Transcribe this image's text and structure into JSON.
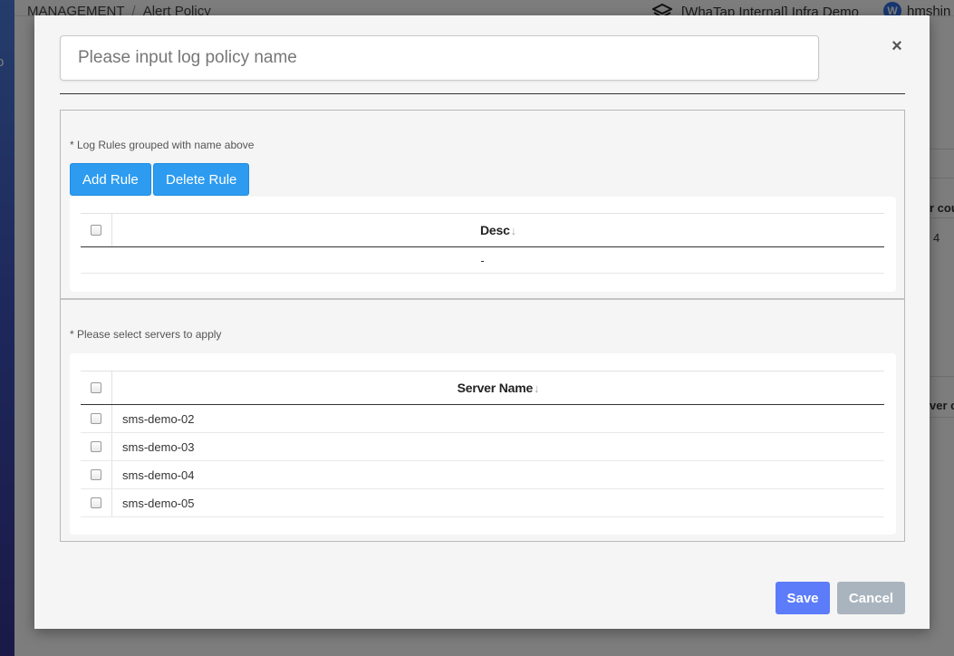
{
  "background": {
    "breadcrumb": {
      "section": "MANAGEMENT",
      "page": "Alert Policy"
    },
    "project_name": "[WhaTap Internal] Infra Demo",
    "user": {
      "avatar_letter": "W",
      "name": "hmshin"
    },
    "right_column": {
      "header_1": "r cou",
      "value_1": "4",
      "header_2": "ver co"
    }
  },
  "modal": {
    "policy_name": {
      "placeholder": "Please input log policy name",
      "value": ""
    },
    "close_symbol": "×",
    "rules_section": {
      "hint": "* Log Rules grouped with name above",
      "add_label": "Add Rule",
      "delete_label": "Delete Rule",
      "table": {
        "column": "Desc",
        "sort_symbol": "↓",
        "rows": [
          "-"
        ]
      }
    },
    "servers_section": {
      "hint": "* Please select servers to apply",
      "table": {
        "column": "Server Name",
        "sort_symbol": "↓",
        "rows": [
          "sms-demo-02",
          "sms-demo-03",
          "sms-demo-04",
          "sms-demo-05"
        ]
      }
    },
    "footer": {
      "save_label": "Save",
      "cancel_label": "Cancel"
    }
  },
  "colors": {
    "primary": "#2d9cf0",
    "save": "#5c7cf9",
    "cancel": "#aab4be"
  }
}
